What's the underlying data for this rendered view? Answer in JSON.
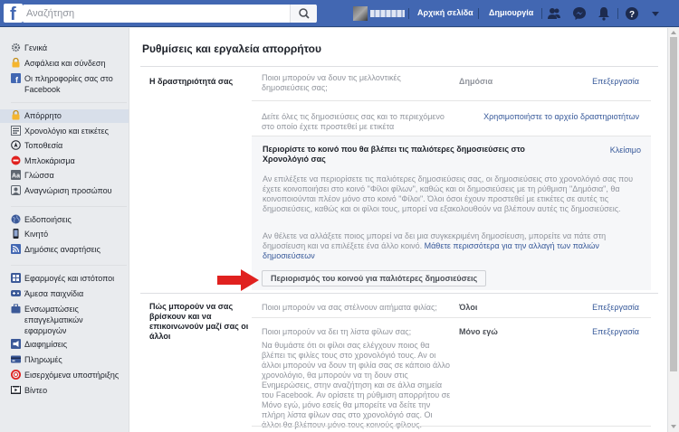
{
  "topbar": {
    "logo": "f",
    "search_placeholder": "Αναζήτηση",
    "nav_home": "Αρχική σελίδα",
    "nav_create": "Δημιουργία",
    "icons": [
      "search-icon",
      "friend-requests-icon",
      "messenger-icon",
      "notifications-icon",
      "help-icon",
      "dropdown-icon"
    ]
  },
  "sidebar": {
    "items": [
      {
        "label": "Γενικά",
        "icon": "gear-icon"
      },
      {
        "label": "Ασφάλεια και σύνδεση",
        "icon": "lock-icon"
      },
      {
        "label": "Οι πληροφορίες σας στο Facebook",
        "icon": "facebook-icon"
      },
      {
        "label": "Απόρρητο",
        "icon": "privacy-lock-icon"
      },
      {
        "label": "Χρονολόγιο και ετικέτες",
        "icon": "timeline-icon"
      },
      {
        "label": "Τοποθεσία",
        "icon": "location-icon"
      },
      {
        "label": "Μπλοκάρισμα",
        "icon": "block-icon"
      },
      {
        "label": "Γλώσσα",
        "icon": "language-icon"
      },
      {
        "label": "Αναγνώριση προσώπου",
        "icon": "face-recognition-icon"
      },
      {
        "label": "Ειδοποιήσεις",
        "icon": "globe-icon"
      },
      {
        "label": "Κινητό",
        "icon": "mobile-icon"
      },
      {
        "label": "Δημόσιες αναρτήσεις",
        "icon": "rss-icon"
      },
      {
        "label": "Εφαρμογές και ιστότοποι",
        "icon": "apps-icon"
      },
      {
        "label": "Άμεσα παιχνίδια",
        "icon": "games-icon"
      },
      {
        "label": "Ενσωματώσεις επαγγελματικών εφαρμογών",
        "icon": "business-integrations-icon"
      },
      {
        "label": "Διαφημίσεις",
        "icon": "ads-icon"
      },
      {
        "label": "Πληρωμές",
        "icon": "payments-icon"
      },
      {
        "label": "Εισερχόμενα υποστήριξης",
        "icon": "support-inbox-icon"
      },
      {
        "label": "Βίντεο",
        "icon": "video-icon"
      }
    ]
  },
  "main": {
    "title": "Ρυθμίσεις και εργαλεία απορρήτου",
    "activity": {
      "section_title": "Η δραστηριότητά σας",
      "row1_desc": "Ποιοι μπορούν να δουν τις μελλοντικές δημοσιεύσεις σας;",
      "row1_value": "Δημόσια",
      "row1_action": "Επεξεργασία",
      "row2_desc": "Δείτε όλες τις δημοσιεύσεις σας και το περιεχόμενο στο οποίο έχετε προστεθεί με ετικέτα",
      "row2_action": "Χρησιμοποιήστε το αρχείο δραστηριοτήτων",
      "expanded_title": "Περιορίστε το κοινό που θα βλέπει τις παλιότερες δημοσιεύσεις στο Χρονολόγιό σας",
      "expanded_close": "Κλείσιμο",
      "expanded_p1": "Αν επιλέξετε να περιορίσετε τις παλιότερες δημοσιεύσεις σας, οι δημοσιεύσεις στο χρονολόγιό σας που έχετε κοινοποιήσει στο κοινό \"Φίλοι φίλων\", καθώς και οι δημοσιεύσεις με τη ρύθμιση \"Δημόσια\", θα κοινοποιούνται πλέον μόνο στο κοινό \"Φίλοι\". Όλοι όσοι έχουν προστεθεί με ετικέτες σε αυτές τις δημοσιεύσεις, καθώς και οι φίλοι τους, μπορεί να εξακολουθούν να βλέπουν αυτές τις δημοσιεύσεις.",
      "expanded_p2": "Αν θέλετε να αλλάξετε ποιος μπορεί να δει μια συγκεκριμένη δημοσίευση, μπορείτε να πάτε στη δημοσίευση και να επιλέξετε ένα άλλο κοινό.",
      "expanded_p2_link": "Μάθετε περισσότερα για την αλλαγή των παλιών δημοσιεύσεων",
      "limit_button": "Περιορισμός του κοινού για παλιότερες δημοσιεύσεις"
    },
    "contact": {
      "section_title": "Πώς μπορούν να σας βρίσκουν και να επικοινωνούν μαζί σας οι άλλοι",
      "row1_desc": "Ποιοι μπορούν να σας στέλνουν αιτήματα φιλίας;",
      "row1_value": "Όλοι",
      "row1_action": "Επεξεργασία",
      "row2_desc": "Ποιοι μπορούν να δει τη λίστα φίλων σας;",
      "row2_value": "Μόνο εγώ",
      "row2_action": "Επεξεργασία",
      "row2_note": "Να θυμάστε ότι οι φίλοι σας ελέγχουν ποιος θα βλέπει τις φιλίες τους στο χρονολόγιό τους. Αν οι άλλοι μπορούν να δουν τη φιλία σας σε κάποιο άλλο χρονολόγιο, θα μπορούν να τη δουν στις Ενημερώσεις, στην αναζήτηση και σε άλλα σημεία του Facebook. Αν ορίσετε τη ρύθμιση απορρήτου σε Μόνο εγώ, μόνο εσείς θα μπορείτε να δείτε την πλήρη λίστα φίλων σας στο χρονολόγιό σας. Οι άλλοι θα βλέπουν μόνο τους κοινούς φίλους."
    }
  },
  "colors": {
    "topbar": "#4267b2",
    "link": "#365899",
    "arrow": "#e0211f"
  }
}
